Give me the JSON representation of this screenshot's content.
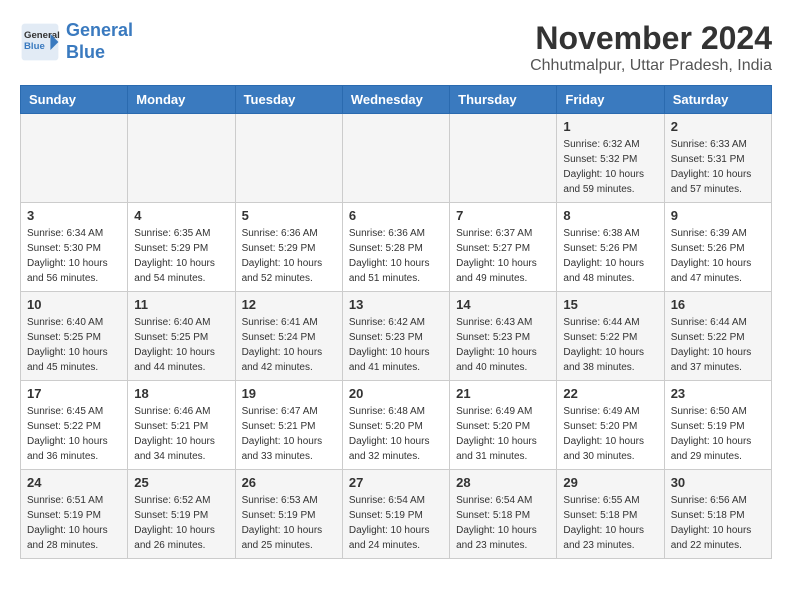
{
  "logo": {
    "line1": "General",
    "line2": "Blue"
  },
  "title": "November 2024",
  "subtitle": "Chhutmalpur, Uttar Pradesh, India",
  "days_of_week": [
    "Sunday",
    "Monday",
    "Tuesday",
    "Wednesday",
    "Thursday",
    "Friday",
    "Saturday"
  ],
  "weeks": [
    [
      {
        "day": "",
        "info": ""
      },
      {
        "day": "",
        "info": ""
      },
      {
        "day": "",
        "info": ""
      },
      {
        "day": "",
        "info": ""
      },
      {
        "day": "",
        "info": ""
      },
      {
        "day": "1",
        "info": "Sunrise: 6:32 AM\nSunset: 5:32 PM\nDaylight: 10 hours and 59 minutes."
      },
      {
        "day": "2",
        "info": "Sunrise: 6:33 AM\nSunset: 5:31 PM\nDaylight: 10 hours and 57 minutes."
      }
    ],
    [
      {
        "day": "3",
        "info": "Sunrise: 6:34 AM\nSunset: 5:30 PM\nDaylight: 10 hours and 56 minutes."
      },
      {
        "day": "4",
        "info": "Sunrise: 6:35 AM\nSunset: 5:29 PM\nDaylight: 10 hours and 54 minutes."
      },
      {
        "day": "5",
        "info": "Sunrise: 6:36 AM\nSunset: 5:29 PM\nDaylight: 10 hours and 52 minutes."
      },
      {
        "day": "6",
        "info": "Sunrise: 6:36 AM\nSunset: 5:28 PM\nDaylight: 10 hours and 51 minutes."
      },
      {
        "day": "7",
        "info": "Sunrise: 6:37 AM\nSunset: 5:27 PM\nDaylight: 10 hours and 49 minutes."
      },
      {
        "day": "8",
        "info": "Sunrise: 6:38 AM\nSunset: 5:26 PM\nDaylight: 10 hours and 48 minutes."
      },
      {
        "day": "9",
        "info": "Sunrise: 6:39 AM\nSunset: 5:26 PM\nDaylight: 10 hours and 47 minutes."
      }
    ],
    [
      {
        "day": "10",
        "info": "Sunrise: 6:40 AM\nSunset: 5:25 PM\nDaylight: 10 hours and 45 minutes."
      },
      {
        "day": "11",
        "info": "Sunrise: 6:40 AM\nSunset: 5:25 PM\nDaylight: 10 hours and 44 minutes."
      },
      {
        "day": "12",
        "info": "Sunrise: 6:41 AM\nSunset: 5:24 PM\nDaylight: 10 hours and 42 minutes."
      },
      {
        "day": "13",
        "info": "Sunrise: 6:42 AM\nSunset: 5:23 PM\nDaylight: 10 hours and 41 minutes."
      },
      {
        "day": "14",
        "info": "Sunrise: 6:43 AM\nSunset: 5:23 PM\nDaylight: 10 hours and 40 minutes."
      },
      {
        "day": "15",
        "info": "Sunrise: 6:44 AM\nSunset: 5:22 PM\nDaylight: 10 hours and 38 minutes."
      },
      {
        "day": "16",
        "info": "Sunrise: 6:44 AM\nSunset: 5:22 PM\nDaylight: 10 hours and 37 minutes."
      }
    ],
    [
      {
        "day": "17",
        "info": "Sunrise: 6:45 AM\nSunset: 5:22 PM\nDaylight: 10 hours and 36 minutes."
      },
      {
        "day": "18",
        "info": "Sunrise: 6:46 AM\nSunset: 5:21 PM\nDaylight: 10 hours and 34 minutes."
      },
      {
        "day": "19",
        "info": "Sunrise: 6:47 AM\nSunset: 5:21 PM\nDaylight: 10 hours and 33 minutes."
      },
      {
        "day": "20",
        "info": "Sunrise: 6:48 AM\nSunset: 5:20 PM\nDaylight: 10 hours and 32 minutes."
      },
      {
        "day": "21",
        "info": "Sunrise: 6:49 AM\nSunset: 5:20 PM\nDaylight: 10 hours and 31 minutes."
      },
      {
        "day": "22",
        "info": "Sunrise: 6:49 AM\nSunset: 5:20 PM\nDaylight: 10 hours and 30 minutes."
      },
      {
        "day": "23",
        "info": "Sunrise: 6:50 AM\nSunset: 5:19 PM\nDaylight: 10 hours and 29 minutes."
      }
    ],
    [
      {
        "day": "24",
        "info": "Sunrise: 6:51 AM\nSunset: 5:19 PM\nDaylight: 10 hours and 28 minutes."
      },
      {
        "day": "25",
        "info": "Sunrise: 6:52 AM\nSunset: 5:19 PM\nDaylight: 10 hours and 26 minutes."
      },
      {
        "day": "26",
        "info": "Sunrise: 6:53 AM\nSunset: 5:19 PM\nDaylight: 10 hours and 25 minutes."
      },
      {
        "day": "27",
        "info": "Sunrise: 6:54 AM\nSunset: 5:19 PM\nDaylight: 10 hours and 24 minutes."
      },
      {
        "day": "28",
        "info": "Sunrise: 6:54 AM\nSunset: 5:18 PM\nDaylight: 10 hours and 23 minutes."
      },
      {
        "day": "29",
        "info": "Sunrise: 6:55 AM\nSunset: 5:18 PM\nDaylight: 10 hours and 23 minutes."
      },
      {
        "day": "30",
        "info": "Sunrise: 6:56 AM\nSunset: 5:18 PM\nDaylight: 10 hours and 22 minutes."
      }
    ]
  ]
}
